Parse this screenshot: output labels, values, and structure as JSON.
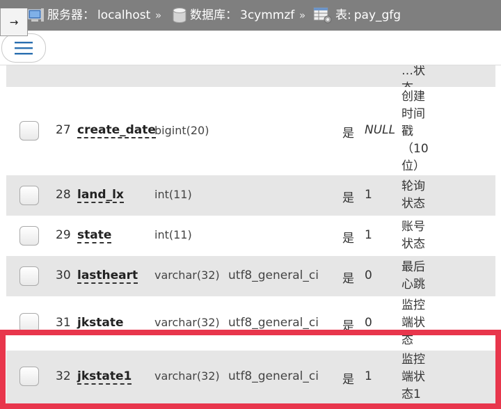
{
  "breadcrumb": {
    "arrow": "→",
    "server_label": "服务器：",
    "server_value": "localhost",
    "sep": "»",
    "db_label": "数据库：",
    "db_value": "3cymmzf",
    "table_label": "表:",
    "table_value": "pay_gfg"
  },
  "icons": {
    "arrow": "right-arrow-icon",
    "server": "server-icon",
    "database": "database-icon",
    "table": "table-icon",
    "menu": "hamburger-menu-icon",
    "checkbox": "checkbox-icon"
  },
  "top_partial_row": {
    "comment": "…状态"
  },
  "rows": [
    {
      "num": "27",
      "name": "create_date",
      "type": "bigint(20)",
      "collation": "",
      "null": "是",
      "default": "NULL",
      "default_italic": true,
      "comment": "创建时间戳（10位）"
    },
    {
      "num": "28",
      "name": "land_lx",
      "type": "int(11)",
      "collation": "",
      "null": "是",
      "default": "1",
      "comment": "轮询状态"
    },
    {
      "num": "29",
      "name": "state",
      "type": "int(11)",
      "collation": "",
      "null": "是",
      "default": "1",
      "comment": "账号状态"
    },
    {
      "num": "30",
      "name": "lastheart",
      "type": "varchar(32)",
      "collation": "utf8_general_ci",
      "null": "是",
      "default": "0",
      "comment": "最后心跳"
    },
    {
      "num": "31",
      "name": "jkstate",
      "type": "varchar(32)",
      "collation": "utf8_general_ci",
      "null": "是",
      "default": "0",
      "comment": "监控端状态"
    },
    {
      "num": "32",
      "name": "jkstate1",
      "type": "varchar(32)",
      "collation": "utf8_general_ci",
      "null": "是",
      "default": "1",
      "comment": "监控端状态1"
    }
  ],
  "colors": {
    "highlight": "#e8364c",
    "topbar": "#7f7f7f",
    "row_alt": "#e6e6e6"
  }
}
